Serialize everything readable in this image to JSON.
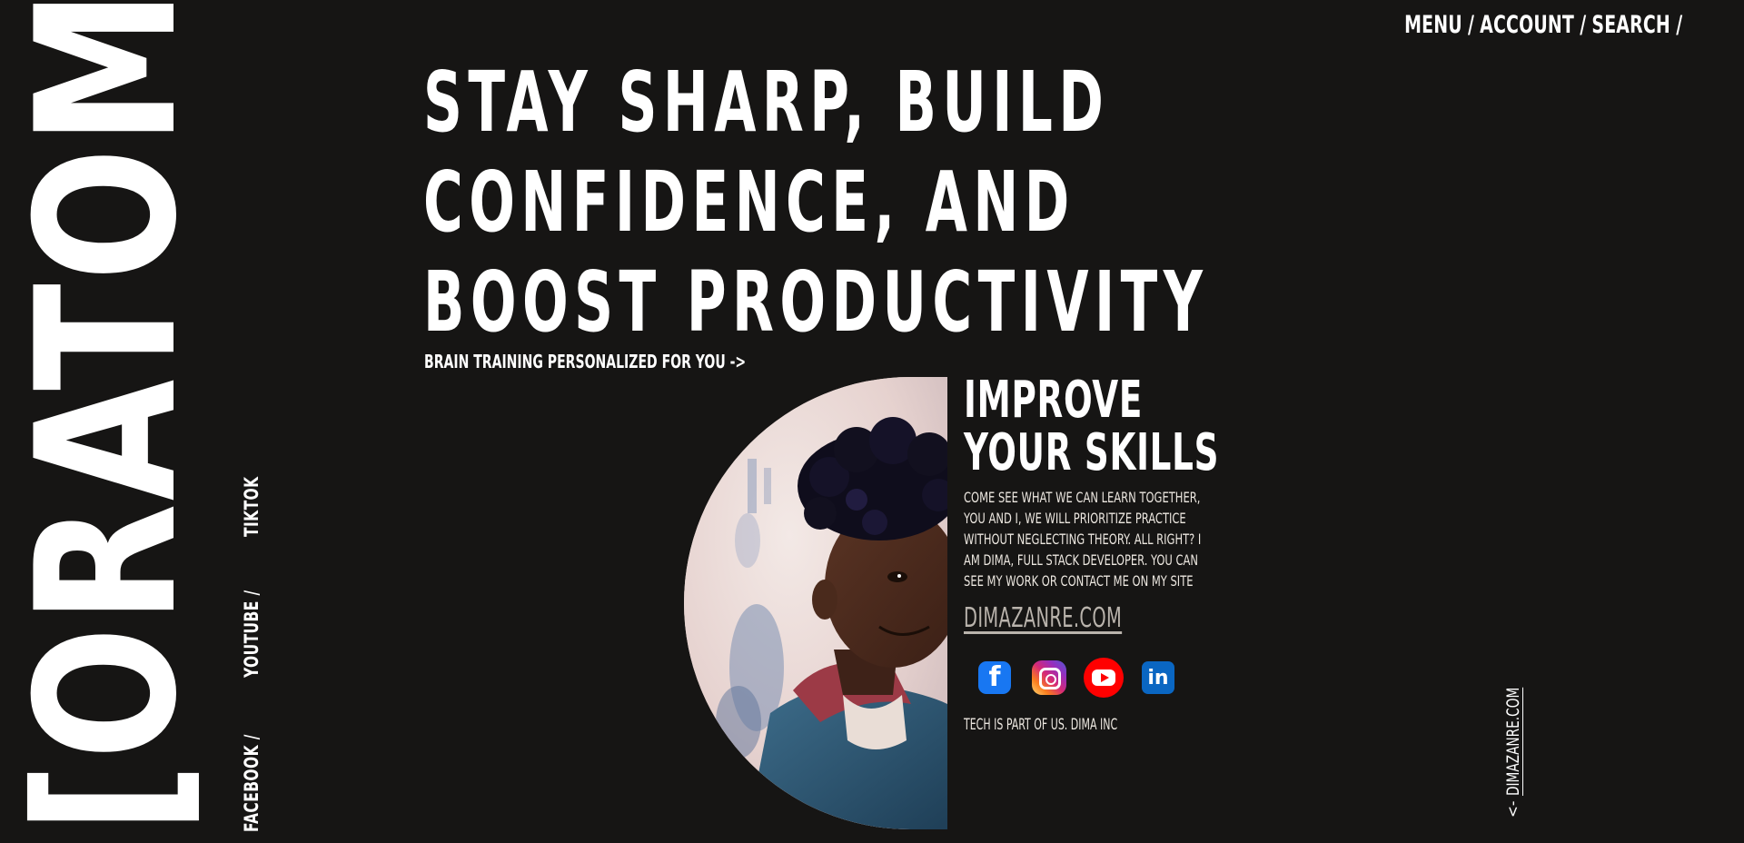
{
  "brand": {
    "logo_text": "[ORATOMIND]"
  },
  "topnav": {
    "items": [
      {
        "label": "MENU"
      },
      {
        "label": "ACCOUNT"
      },
      {
        "label": "SEARCH"
      }
    ],
    "separator": "/"
  },
  "socials": {
    "items": [
      {
        "label": "FACEBOOK /"
      },
      {
        "label": "YOUTUBE /"
      },
      {
        "label": "TIKTOK"
      }
    ]
  },
  "hero": {
    "lines": [
      "STAY SHARP, BUILD",
      "CONFIDENCE, AND",
      "BOOST PRODUCTIVITY"
    ],
    "subtitle": "BRAIN TRAINING PERSONALIZED FOR YOU ->"
  },
  "skills": {
    "title_line_1": "IMPROVE",
    "title_line_2": "YOUR SKILLS",
    "body": "COME SEE WHAT WE CAN LEARN TOGETHER, YOU AND I, WE WILL PRIORITIZE PRACTICE WITHOUT NEGLECTING THEORY. ALL RIGHT? I AM DIMA, FULL STACK DEVELOPER. YOU CAN SEE MY WORK OR CONTACT ME ON MY SITE",
    "link": "DIMAZANRE.COM",
    "footer": "TECH IS PART OF US. DIMA INC",
    "icons": {
      "facebook_glyph": "f",
      "linkedin_glyph": "in"
    }
  },
  "side_link": {
    "arrow": "<-",
    "label": "DIMAZANRE.COM"
  },
  "colors": {
    "background": "#161514",
    "text": "#ffffff",
    "muted_link": "#b9b3ac",
    "facebook": "#1877f2",
    "youtube": "#ff0000",
    "linkedin": "#0a66c2"
  }
}
